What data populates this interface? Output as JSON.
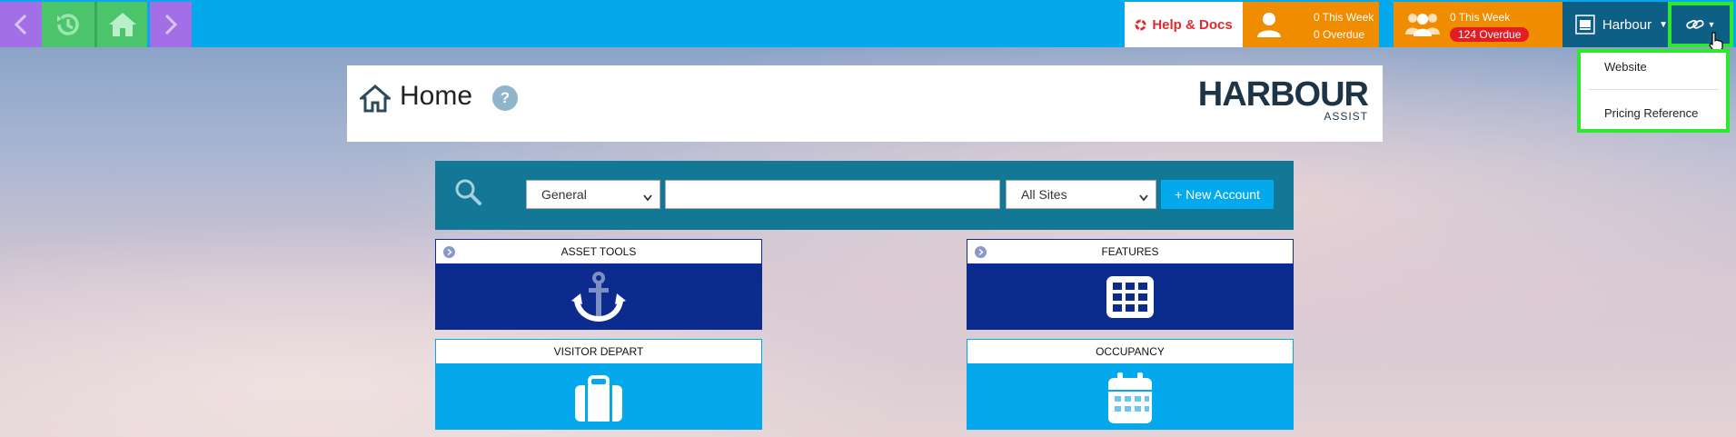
{
  "topbar": {
    "help_label": "Help & Docs",
    "my_tasks": {
      "this_week": "0 This Week",
      "overdue": "0 Overdue"
    },
    "team_tasks": {
      "this_week": "0 This Week",
      "overdue": "124 Overdue"
    },
    "harbour_label": "Harbour"
  },
  "links_dropdown": {
    "items": [
      {
        "label": "Website"
      },
      {
        "label": "Pricing Reference"
      }
    ]
  },
  "header": {
    "title": "Home",
    "logo_main": "HARBOUR",
    "logo_sub": "ASSIST"
  },
  "search": {
    "category_selected": "General",
    "site_selected": "All Sites",
    "query": "",
    "new_account_label": "+ New Account"
  },
  "tiles": [
    {
      "label": "ASSET TOOLS",
      "icon": "anchor-icon"
    },
    {
      "label": "FEATURES",
      "icon": "grid-icon"
    },
    {
      "label": "VISITOR DEPART",
      "icon": "suitcase-icon"
    },
    {
      "label": "OCCUPANCY",
      "icon": "calendar-icon"
    }
  ],
  "colors": {
    "topbar": "#03a9ec",
    "nav_purple": "#a36fe6",
    "nav_green": "#4cc46c",
    "tasks_orange": "#f08c00",
    "harbour_blue": "#0d5f86",
    "highlight_green": "#2ee82e",
    "tile_dark": "#0c2b8f",
    "tile_light": "#03a9ec",
    "overdue_red": "#e21d24"
  }
}
